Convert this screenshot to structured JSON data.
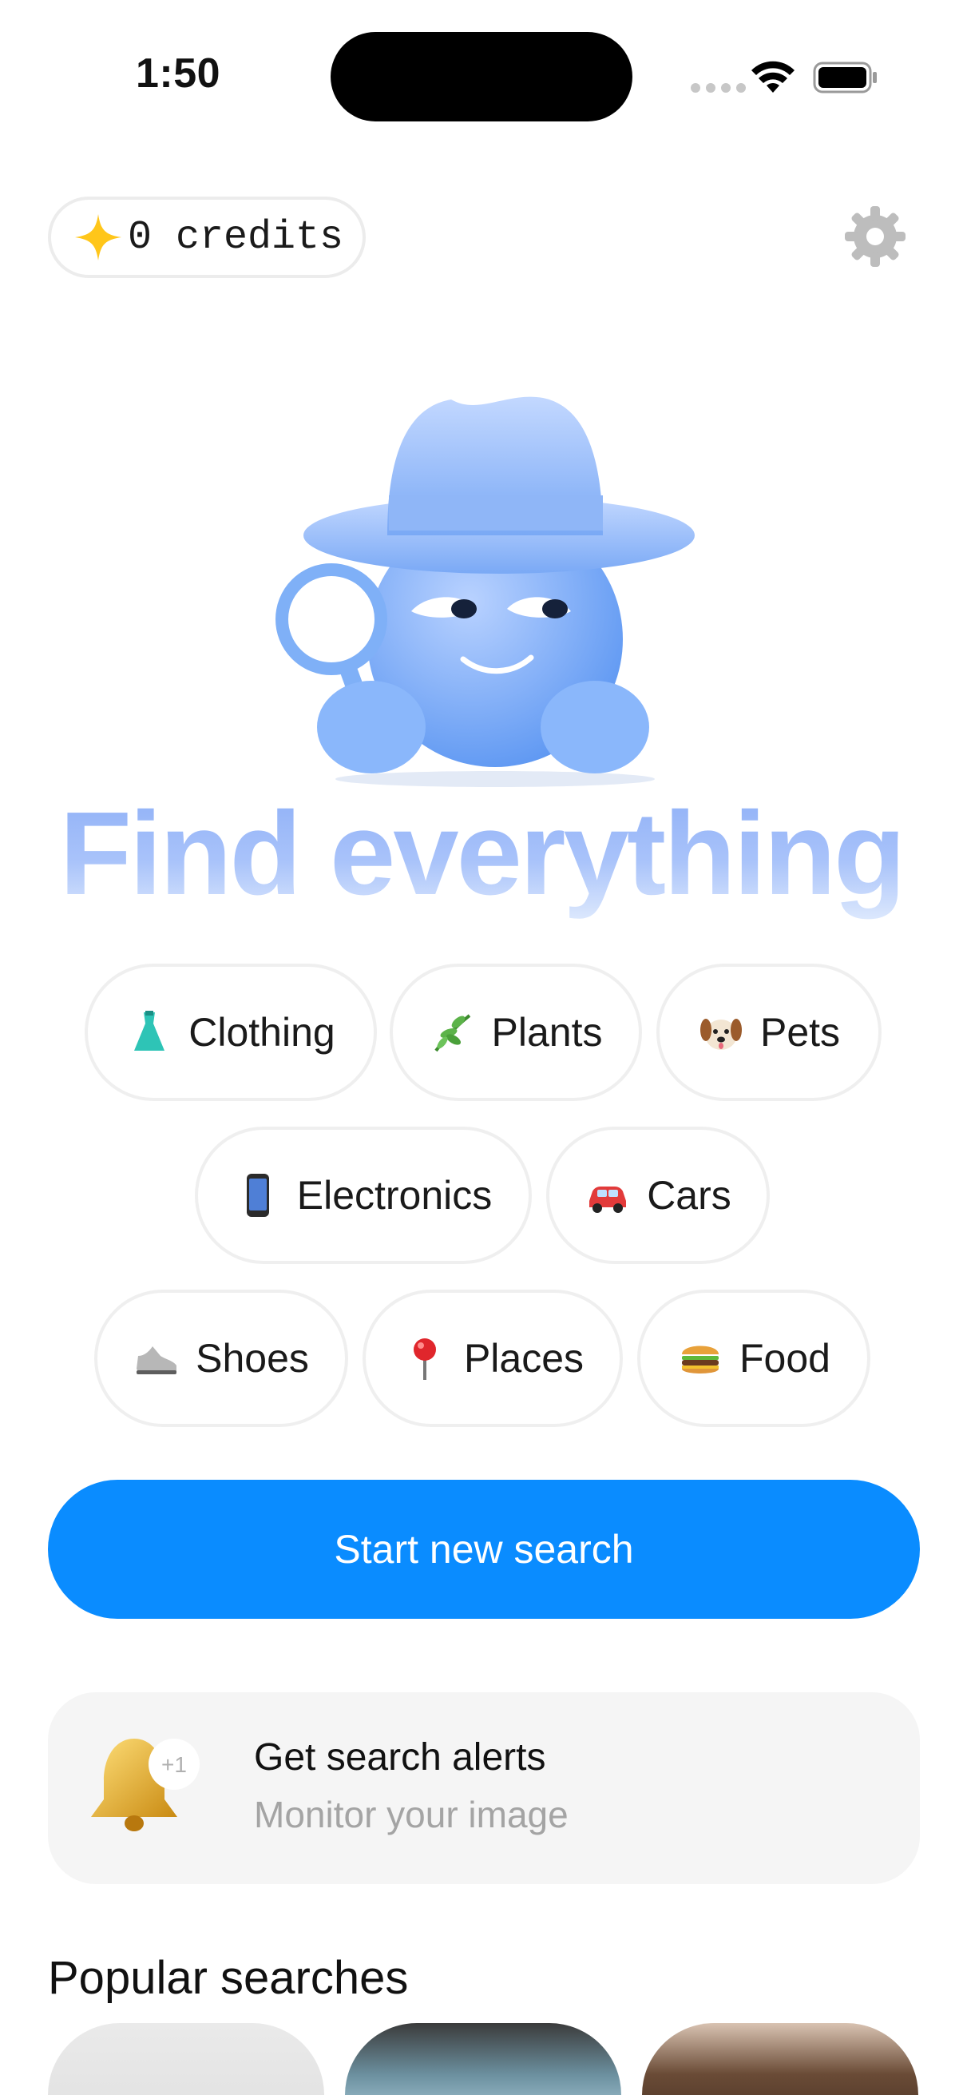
{
  "status_bar": {
    "time": "1:50"
  },
  "header": {
    "credits_label": "0 credits"
  },
  "headline": "Find everything",
  "categories": [
    {
      "emoji": "👗",
      "label": "Clothing"
    },
    {
      "emoji": "🌿",
      "label": "Plants"
    },
    {
      "emoji": "🐶",
      "label": "Pets"
    },
    {
      "emoji": "📱",
      "label": "Electronics"
    },
    {
      "emoji": "🚗",
      "label": "Cars"
    },
    {
      "emoji": "👟",
      "label": "Shoes"
    },
    {
      "emoji": "📍",
      "label": "Places"
    },
    {
      "emoji": "🍔",
      "label": "Food"
    }
  ],
  "cta": {
    "label": "Start new search"
  },
  "alerts": {
    "title": "Get search alerts",
    "subtitle": "Monitor your image",
    "badge": "+1"
  },
  "popular": {
    "title": "Popular searches"
  },
  "colors": {
    "accent": "#0a8cff",
    "headline_gradient_top": "#8fb0f7",
    "card_bg": "#f5f5f5"
  }
}
